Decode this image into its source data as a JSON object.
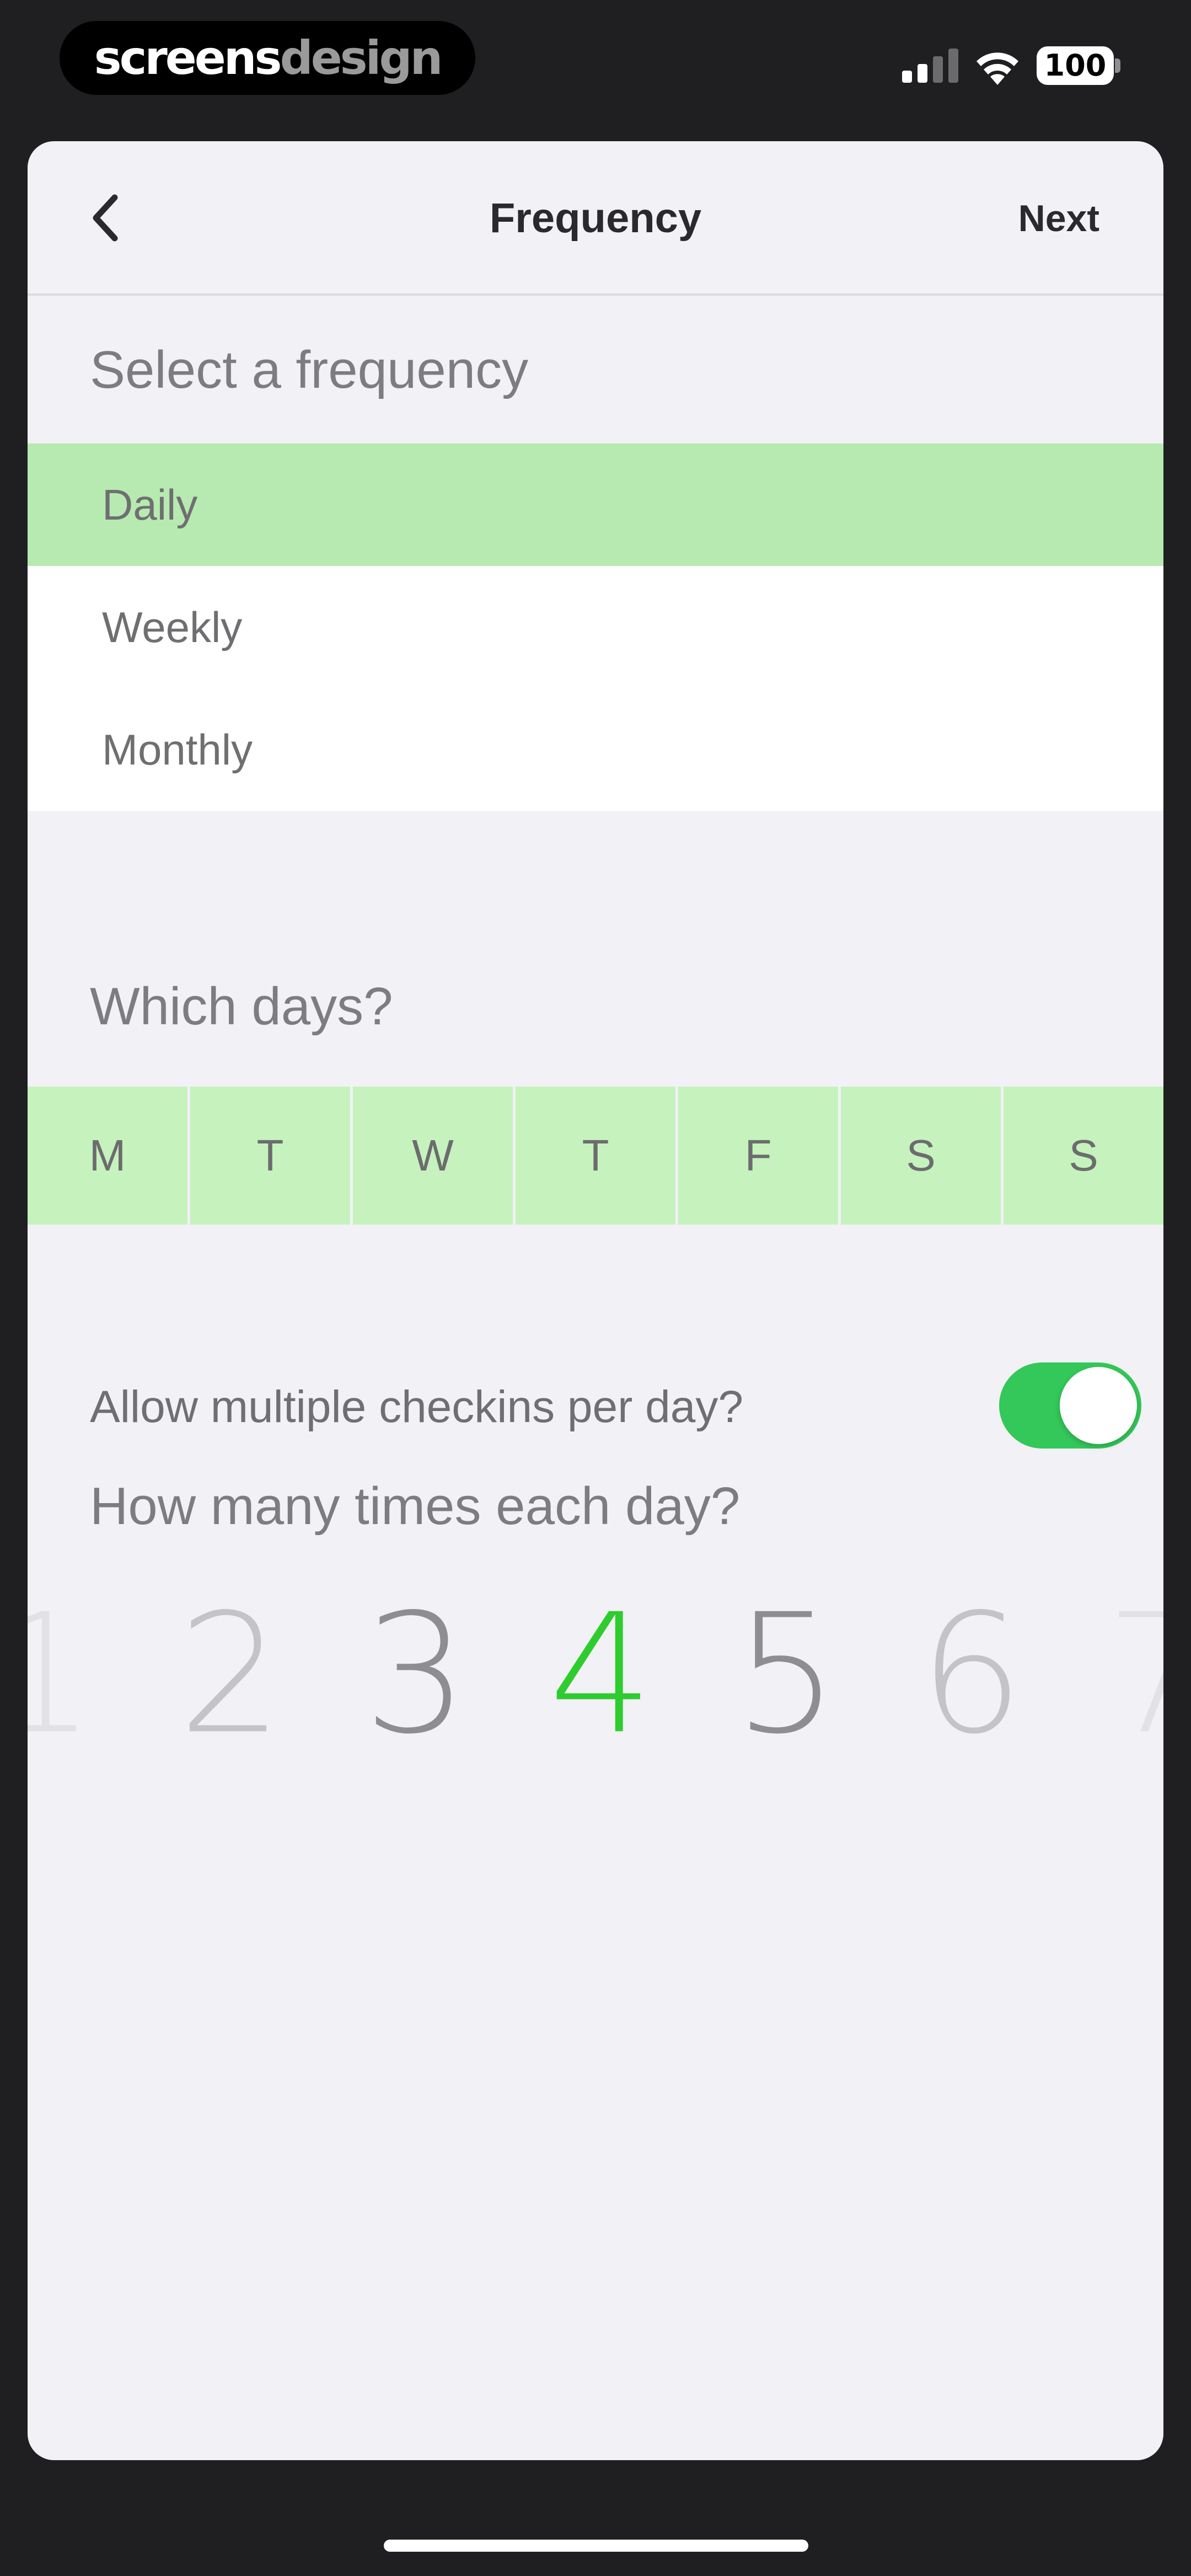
{
  "status_bar": {
    "brand_part1": "screens",
    "brand_part2": "design",
    "battery": "100",
    "signal_icon": "cellular-signal-icon",
    "wifi_icon": "wifi-icon"
  },
  "nav": {
    "title": "Frequency",
    "next_label": "Next",
    "back_icon": "chevron-left-icon"
  },
  "frequency": {
    "header": "Select a frequency",
    "options": [
      {
        "label": "Daily",
        "selected": true
      },
      {
        "label": "Weekly",
        "selected": false
      },
      {
        "label": "Monthly",
        "selected": false
      }
    ]
  },
  "days": {
    "header": "Which days?",
    "items": [
      "M",
      "T",
      "W",
      "T",
      "F",
      "S",
      "S"
    ]
  },
  "multiple_checkins": {
    "label": "Allow multiple checkins per day?",
    "enabled": true
  },
  "times_per_day": {
    "header": "How many times each day?",
    "numbers": [
      "1",
      "2",
      "3",
      "4",
      "5",
      "6",
      "7"
    ],
    "selected": "4"
  },
  "colors": {
    "selected_row": "#b7eab0",
    "day_cell": "#c5f2bd",
    "toggle_on": "#34c759",
    "picker_selected": "#2ecc2e"
  }
}
